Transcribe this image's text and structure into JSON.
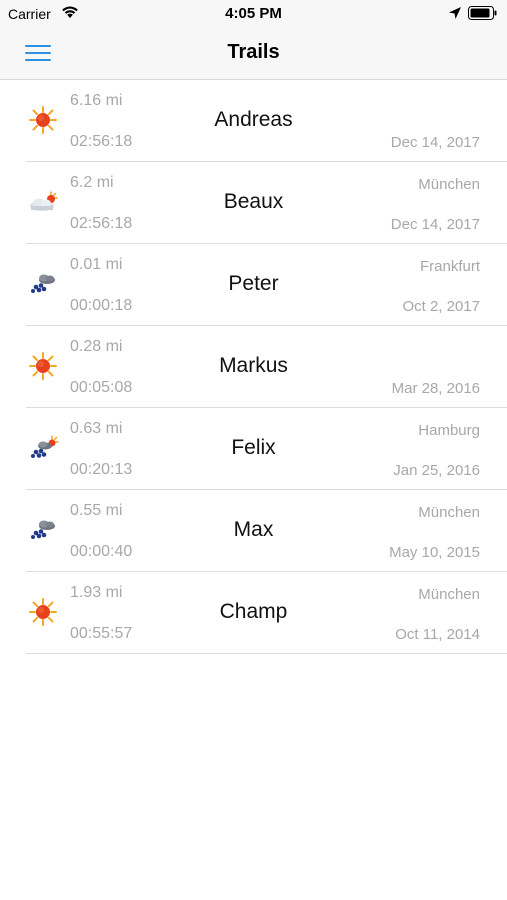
{
  "status": {
    "carrier": "Carrier",
    "time": "4:05 PM"
  },
  "nav": {
    "title": "Trails",
    "menu_icon": "hamburger-menu-icon"
  },
  "trails": [
    {
      "name": "Andreas",
      "distance": "6.16 mi",
      "duration": "02:56:18",
      "city": "",
      "date": "Dec 14, 2017",
      "weather": "sunny"
    },
    {
      "name": "Beaux",
      "distance": "6.2 mi",
      "duration": "02:56:18",
      "city": "München",
      "date": "Dec 14, 2017",
      "weather": "partly-cloudy"
    },
    {
      "name": "Peter",
      "distance": "0.01 mi",
      "duration": "00:00:18",
      "city": "Frankfurt",
      "date": "Oct 2, 2017",
      "weather": "rain"
    },
    {
      "name": "Markus",
      "distance": "0.28 mi",
      "duration": "00:05:08",
      "city": "",
      "date": "Mar 28, 2016",
      "weather": "sunny"
    },
    {
      "name": "Felix",
      "distance": "0.63 mi",
      "duration": "00:20:13",
      "city": "Hamburg",
      "date": "Jan 25, 2016",
      "weather": "sun-rain"
    },
    {
      "name": "Max",
      "distance": "0.55 mi",
      "duration": "00:00:40",
      "city": "München",
      "date": "May 10, 2015",
      "weather": "rain"
    },
    {
      "name": "Champ",
      "distance": "1.93 mi",
      "duration": "00:55:57",
      "city": "München",
      "date": "Oct 11, 2014",
      "weather": "sunny"
    }
  ],
  "colors": {
    "accent": "#2f8fe0",
    "secondary_text": "#a8a8a8",
    "separator": "#dcdcdc",
    "nav_background": "#f7f7f7"
  }
}
